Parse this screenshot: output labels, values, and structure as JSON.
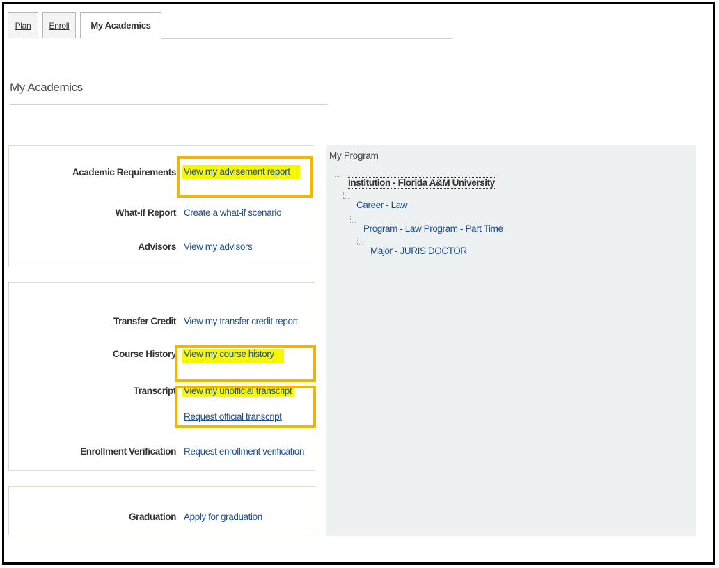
{
  "tabs": {
    "plan": "Plan",
    "enroll": "Enroll",
    "my_academics": "My Academics"
  },
  "page_title": "My Academics",
  "groups": {
    "requirements": [
      {
        "label": "Academic Requirements",
        "link": "View my advisement report"
      },
      {
        "label": "What-If Report",
        "link": "Create a what-if scenario"
      },
      {
        "label": "Advisors",
        "link": "View my advisors"
      }
    ],
    "records": {
      "transfer": {
        "label": "Transfer Credit",
        "link": "View my transfer credit report"
      },
      "history": {
        "label": "Course History",
        "link": "View my course history"
      },
      "transcript": {
        "label": "Transcript",
        "link": "View my unofficial transcript",
        "link2": "Request official transcript"
      },
      "enrollment": {
        "label": "Enrollment Verification",
        "link": "Request enrollment verification"
      }
    },
    "graduation": {
      "label": "Graduation",
      "link": "Apply for graduation"
    }
  },
  "program": {
    "title": "My Program",
    "tree": [
      "Institution - Florida A&M University",
      "Career - Law",
      "Program - Law Program - Part Time",
      "Major - JURIS DOCTOR"
    ]
  },
  "colors": {
    "highlight": "#f7f700",
    "annotation_box": "#f2b600",
    "link": "#1f4e8c"
  }
}
